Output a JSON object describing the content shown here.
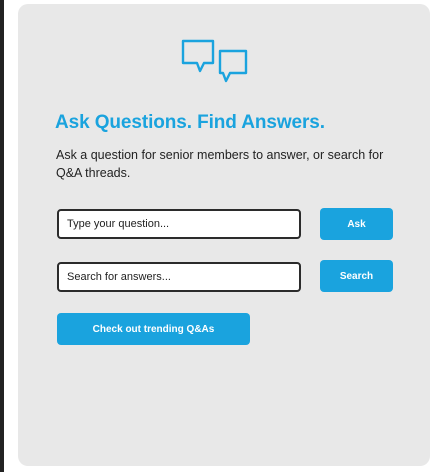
{
  "panel": {
    "icon": "chat-bubbles-icon",
    "title": "Ask Questions. Find Answers.",
    "description": "Ask a question for senior members to answer, or search for Q&A threads."
  },
  "ask": {
    "placeholder": "Type your question...",
    "button_label": "Ask"
  },
  "search": {
    "placeholder": "Search for answers...",
    "button_label": "Search"
  },
  "trending": {
    "button_label": "Check out trending Q&As"
  },
  "colors": {
    "accent": "#1aa3de",
    "card_background": "#e8e8e8",
    "text": "#222222"
  }
}
